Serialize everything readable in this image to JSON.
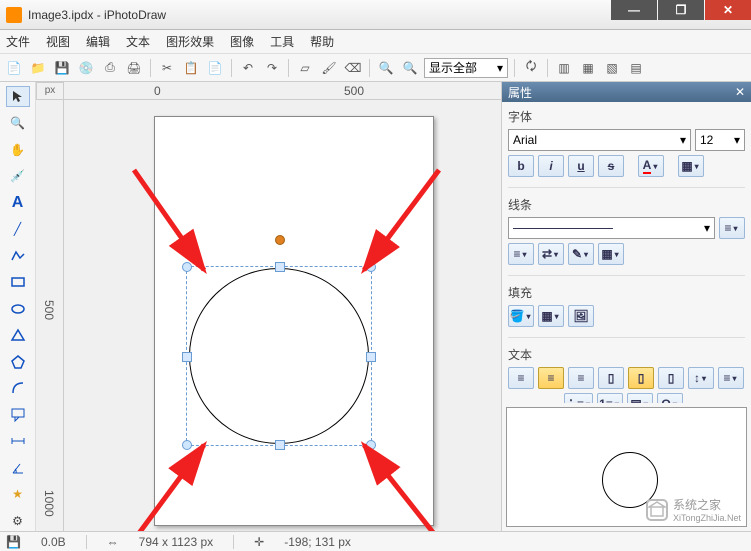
{
  "window": {
    "title": "Image3.ipdx - iPhotoDraw"
  },
  "menu": {
    "file": "文件",
    "view": "视图",
    "edit": "编辑",
    "text": "文本",
    "effect": "图形效果",
    "image": "图像",
    "tool": "工具",
    "help": "帮助"
  },
  "toolbar": {
    "zoom_label": "显示全部"
  },
  "ruler": {
    "unit": "px",
    "tick0": "0",
    "tick500": "500",
    "vtick500": "500",
    "vtick1000": "1000"
  },
  "panel": {
    "title": "属性",
    "font_section": "字体",
    "font_name": "Arial",
    "font_size": "12",
    "bold": "b",
    "italic": "i",
    "underline": "u",
    "strike": "s",
    "font_color": "A",
    "line_section": "线条",
    "fill_section": "填充",
    "text_section": "文本",
    "omega": "Ω"
  },
  "status": {
    "size": "0.0B",
    "dim": "794 x 1123 px",
    "coord": "-198; 131 px"
  },
  "watermark": {
    "text_cn": "系统之家",
    "text_url": "XiTongZhiJia.Net"
  }
}
